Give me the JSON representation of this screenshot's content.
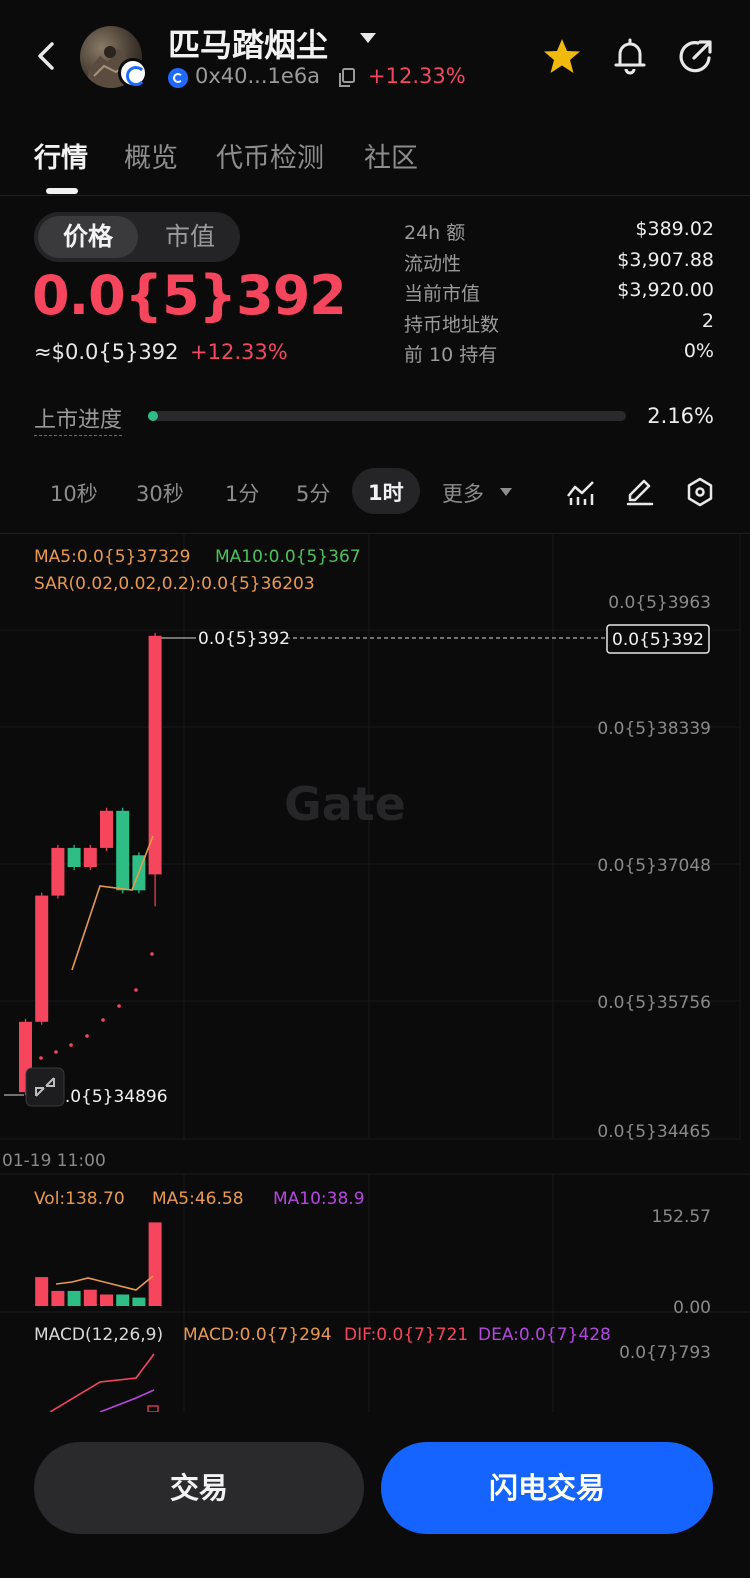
{
  "header": {
    "token_name": "匹马踏烟尘",
    "address": "0x40...1e6a",
    "change": "+12.33%"
  },
  "tabs": [
    {
      "label": "行情",
      "active": true
    },
    {
      "label": "概览",
      "active": false
    },
    {
      "label": "代币检测",
      "active": false
    },
    {
      "label": "社区",
      "active": false
    }
  ],
  "toggle": {
    "price": "价格",
    "market_cap": "市值"
  },
  "price": {
    "main": "0.0{5}392",
    "usd": "≈$0.0{5}392",
    "change": "+12.33%"
  },
  "stats": [
    {
      "label": "24h  额",
      "value": "$389.02"
    },
    {
      "label": "流动性",
      "value": "$3,907.88"
    },
    {
      "label": "当前市值",
      "value": "$3,920.00"
    },
    {
      "label": "持币地址数",
      "value": "2"
    },
    {
      "label": "前 10 持有",
      "value": "0%"
    }
  ],
  "listing_progress": {
    "label": "上市进度",
    "value": "2.16%",
    "fraction": 0.0216
  },
  "intervals": {
    "items": [
      "10秒",
      "30秒",
      "1分",
      "5分",
      "1时"
    ],
    "active": "1时",
    "more": "更多"
  },
  "indicators": {
    "ma5": "MA5:0.0{5}37329",
    "ma10": "MA10:0.0{5}367",
    "sar": "SAR(0.02,0.02,0.2):0.0{5}36203",
    "vol": "Vol:138.70",
    "vol_ma5": "MA5:46.58",
    "vol_ma10": "MA10:38.9",
    "macd_title": "MACD(12,26,9)",
    "macd_value": "MACD:0.0{7}294",
    "dif": "DIF:0.0{7}721",
    "dea": "DEA:0.0{7}428"
  },
  "chart": {
    "watermark": "Gate",
    "price_axis": [
      "0.0{5}3963",
      "0.0{5}38339",
      "0.0{5}37048",
      "0.0{5}35756",
      "0.0{5}34465"
    ],
    "current_price_tag": "0.0{5}392",
    "high_label": "0.0{5}392",
    "low_label": "0.0{5}34896",
    "time_label": "01-19 11:00",
    "volume_axis": [
      "152.57",
      "0.00"
    ],
    "macd_axis": "0.0{7}793",
    "candles": [
      {
        "open": 34896,
        "close": 35560,
        "up": true
      },
      {
        "open": 35560,
        "close": 36750,
        "up": true
      },
      {
        "open": 36750,
        "close": 37200,
        "up": true
      },
      {
        "open": 37200,
        "close": 37020,
        "up": false
      },
      {
        "open": 37020,
        "close": 37200,
        "up": true
      },
      {
        "open": 37550,
        "close": 37200,
        "up": true
      },
      {
        "open": 37550,
        "close": 36800,
        "up": false
      },
      {
        "open": 37130,
        "close": 36800,
        "up": false
      },
      {
        "open": 36950,
        "close": 39200,
        "up": true
      }
    ],
    "volumes": [
      0,
      48,
      25,
      25,
      27,
      19,
      19,
      14,
      138.7
    ]
  },
  "colors": {
    "up": "#f6465d",
    "down": "#2ebd85",
    "accent": "#1564ff",
    "star": "#f0b90b"
  },
  "buttons": {
    "trade": "交易",
    "flash_trade": "闪电交易"
  }
}
